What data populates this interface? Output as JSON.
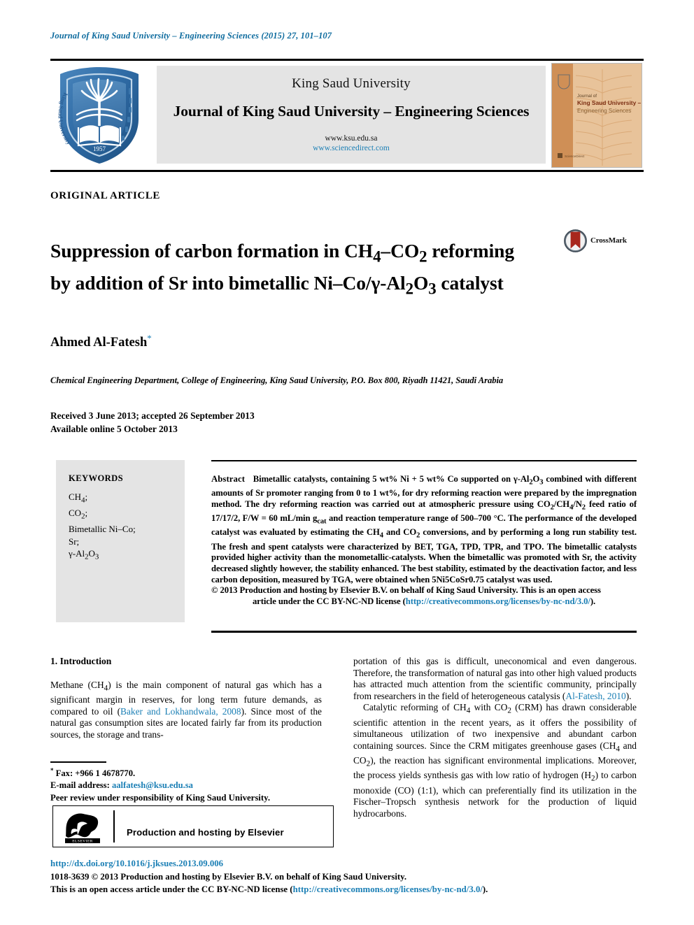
{
  "running_head": "Journal of King Saud University – Engineering Sciences (2015) 27, 101–107",
  "masthead": {
    "university": "King Saud University",
    "journal_title": "Journal of King Saud University – Engineering Sciences",
    "url_ksu": "www.ksu.edu.sa",
    "url_sciencedirect": "www.sciencedirect.com",
    "logo_alt": "King Saud University",
    "cover_alt": "Journal of King Saud University – Engineering Sciences"
  },
  "article": {
    "type_label": "ORIGINAL ARTICLE",
    "title": "Suppression of carbon formation in CH4–CO2 reforming by addition of Sr into bimetallic Ni–Co/γ-Al2O3 catalyst",
    "crossmark_label": "CrossMark",
    "author": "Ahmed Al-Fatesh",
    "author_marker": "*",
    "affiliation": "Chemical Engineering Department, College of Engineering, King Saud University, P.O. Box 800, Riyadh 11421, Saudi Arabia",
    "received_line": "Received 3 June 2013; accepted 26 September 2013",
    "available_line": "Available online 5 October 2013"
  },
  "keywords": {
    "title": "KEYWORDS",
    "items": [
      "CH4;",
      "CO2;",
      "Bimetallic Ni–Co;",
      "Sr;",
      "γ-Al2O3"
    ]
  },
  "abstract": {
    "label": "Abstract",
    "text": "Bimetallic catalysts, containing 5 wt% Ni + 5 wt% Co supported on γ-Al2O3 combined with different amounts of Sr promoter ranging from 0 to 1 wt%, for dry reforming reaction were prepared by the impregnation method. The dry reforming reaction was carried out at atmospheric pressure using CO2/CH4/N2 feed ratio of 17/17/2, F/W = 60 mL/min gcat and reaction temperature range of 500–700 °C. The performance of the developed catalyst was evaluated by estimating the CH4 and CO2 conversions, and by performing a long run stability test. The fresh and spent catalysts were characterized by BET, TGA, TPD, TPR, and TPO. The bimetallic catalysts provided higher activity than the monometallic-catalysts. When the bimetallic was promoted with Sr, the activity decreased slightly however, the stability enhanced. The best stability, estimated by the deactivation factor, and less carbon deposition, measured by TGA, were obtained when 5Ni5CoSr0.75 catalyst was used.",
    "copyright_line": "© 2013 Production and hosting by Elsevier B.V. on behalf of King Saud University. This is an open access",
    "license_prefix": "article under the CC BY-NC-ND license (",
    "license_url": "http://creativecommons.org/licenses/by-nc-nd/3.0/",
    "license_suffix": ")."
  },
  "body": {
    "section_heading": "1. Introduction",
    "left_col_text_1": "Methane (CH4) is the main component of natural gas which has a significant margin in reserves, for long term future demands, as compared to oil (",
    "left_col_citation_1": "Baker and Lokhandwala, 2008",
    "left_col_text_2": "). Since most of the natural gas consumption sites are located fairly far from its production sources, the storage and trans-",
    "right_col_text_1": "portation of this gas is difficult, uneconomical and even dangerous. Therefore, the transformation of natural gas into other high valued products has attracted much attention from the scientific community, principally from researchers in the field of heterogeneous catalysis (",
    "right_col_citation_1": "Al-Fatesh, 2010",
    "right_col_text_2": ").",
    "right_col_para_2": "Catalytic reforming of CH4 with CO2 (CRM) has drawn considerable scientific attention in the recent years, as it offers the possibility of simultaneous utilization of two inexpensive and abundant carbon containing sources. Since the CRM mitigates greenhouse gases (CH4 and CO2), the reaction has significant environmental implications. Moreover, the process yields synthesis gas with low ratio of hydrogen (H2) to carbon monoxide (CO) (1:1), which can preferentially find its utilization in the Fischer–Tropsch synthesis network for the production of liquid hydrocarbons."
  },
  "footnotes": {
    "fax_label": "Fax: +966 1 4678770.",
    "email_label": "E-mail address:",
    "email": "aalfatesh@ksu.edu.sa",
    "peer_review": "Peer review under responsibility of King Saud University.",
    "elsevier_text": "Production and hosting by Elsevier",
    "elsevier_logo_label": "ELSEVIER"
  },
  "footer": {
    "doi": "http://dx.doi.org/10.1016/j.jksues.2013.09.006",
    "issn_line": "1018-3639 © 2013 Production and hosting by Elsevier B.V. on behalf of King Saud University.",
    "license_prefix": "This is an open access article under the CC BY-NC-ND license (",
    "license_url": "http://creativecommons.org/licenses/by-nc-nd/3.0/",
    "license_suffix": ")."
  },
  "colors": {
    "link": "#1b7fb5",
    "running_head": "#0d6b9e",
    "masthead_bg": "#e4e4e4",
    "keywords_bg": "#e4e4e4",
    "logo_blue": "#2e6da4",
    "cover_orange": "#d9a064",
    "crossmark_red": "#a8271d"
  }
}
